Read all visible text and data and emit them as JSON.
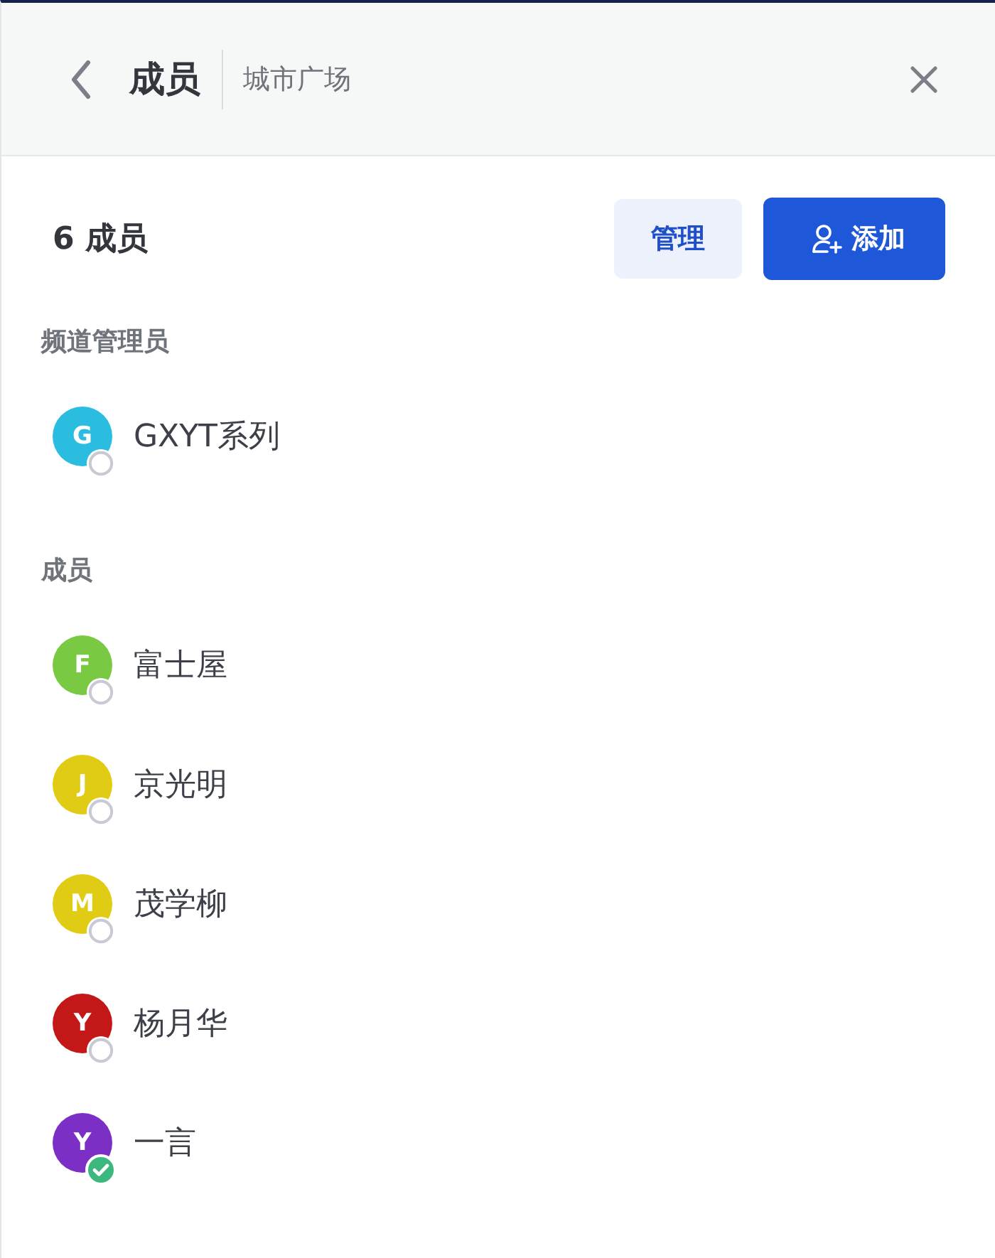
{
  "header": {
    "title": "成员",
    "subtitle": "城市广场"
  },
  "toolbar": {
    "count": "6 成员",
    "buttons": [
      {
        "label": "管理",
        "kind": "secondary"
      },
      {
        "label": "添加",
        "kind": "primary"
      }
    ]
  },
  "sections": [
    {
      "label": "频道管理员",
      "members": [
        {
          "initial": "G",
          "name": "GXYT系列",
          "color": "#2bbde0",
          "online": false
        }
      ]
    },
    {
      "label": "成员",
      "members": [
        {
          "initial": "F",
          "name": "富士屋",
          "color": "#7ac943",
          "online": false
        },
        {
          "initial": "J",
          "name": "京光明",
          "color": "#e0cc14",
          "online": false
        },
        {
          "initial": "M",
          "name": "茂学柳",
          "color": "#e0cc14",
          "online": false
        },
        {
          "initial": "Y",
          "name": "杨月华",
          "color": "#c41818",
          "online": false
        },
        {
          "initial": "Y",
          "name": "一言",
          "color": "#7b2fc4",
          "online": true
        }
      ]
    }
  ]
}
